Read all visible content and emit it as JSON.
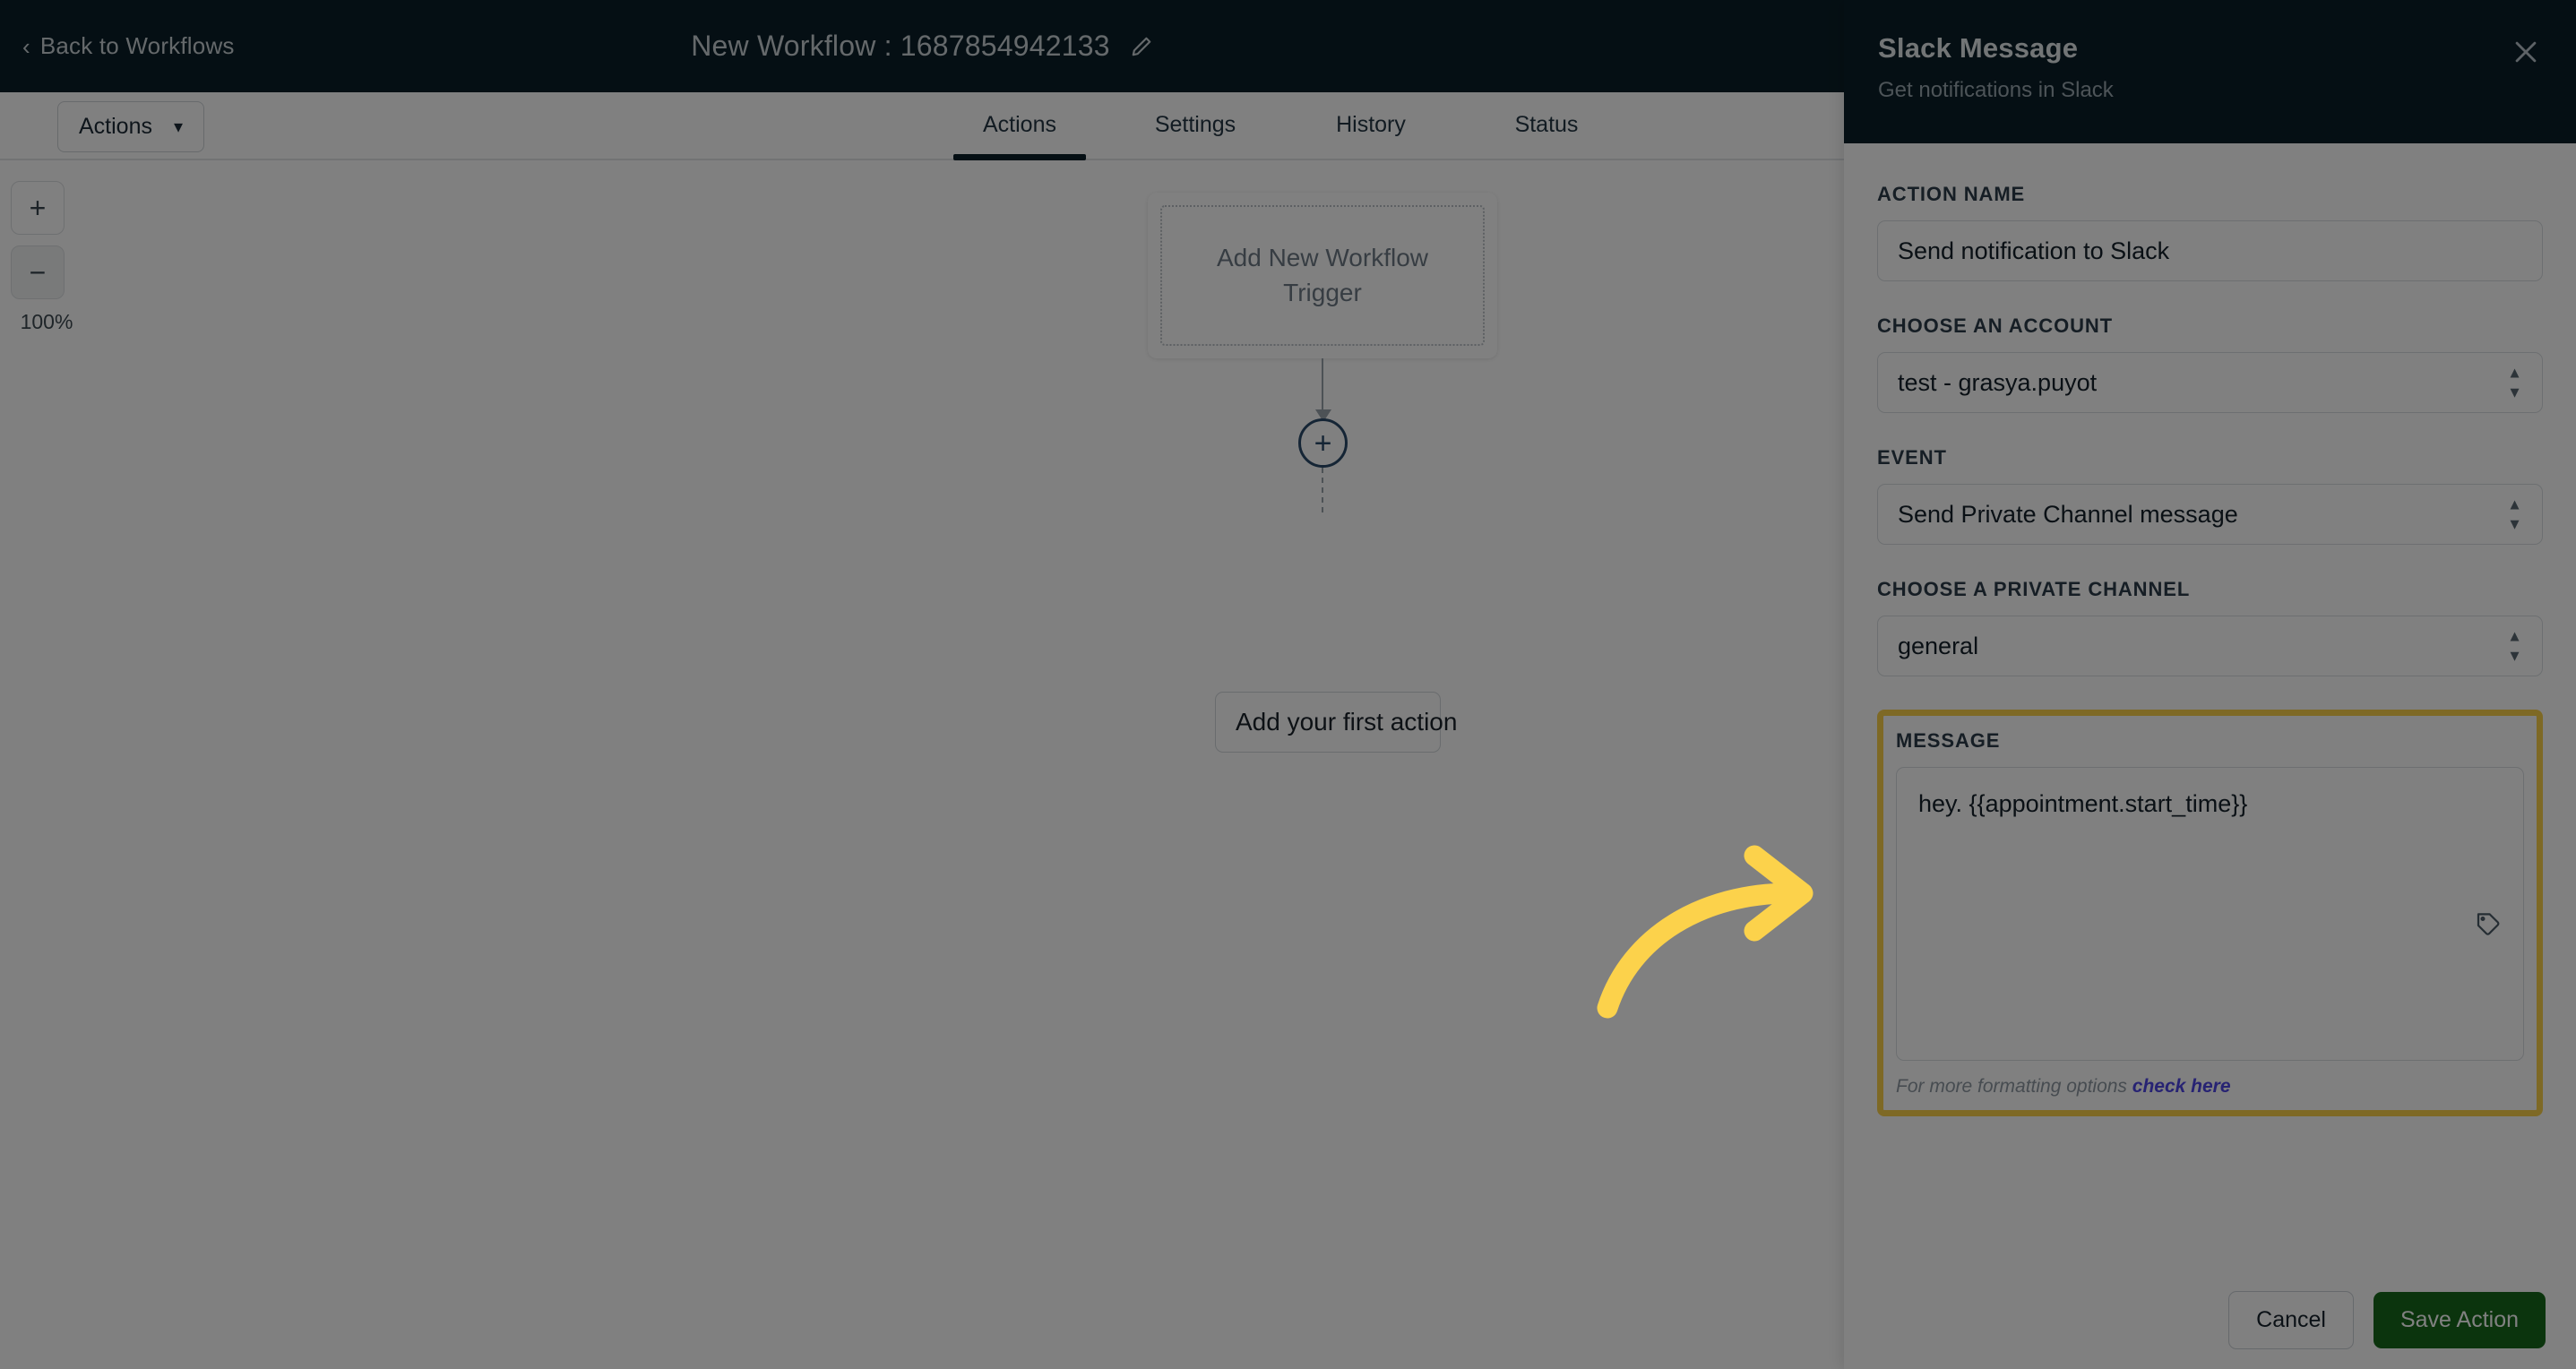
{
  "topbar": {
    "back_label": "Back to Workflows",
    "back_icon": "chevron-left-icon",
    "workflow_title": "New Workflow : 1687854942133",
    "edit_icon": "pencil-icon"
  },
  "toolbar": {
    "actions_dropdown_label": "Actions",
    "caret_icon": "chevron-down-icon"
  },
  "tabs": [
    {
      "label": "Actions",
      "active": true
    },
    {
      "label": "Settings",
      "active": false
    },
    {
      "label": "History",
      "active": false
    },
    {
      "label": "Status",
      "active": false
    }
  ],
  "canvas": {
    "zoom": {
      "in_label": "+",
      "out_label": "−",
      "level": "100%"
    },
    "trigger_card_label": "Add New Workflow Trigger",
    "add_node_label": "+",
    "first_action_label": "Add your first action"
  },
  "panel": {
    "title": "Slack Message",
    "subtitle": "Get notifications in Slack",
    "close_icon": "close-icon",
    "fields": {
      "action_name": {
        "label": "ACTION NAME",
        "value": "Send notification to Slack"
      },
      "account": {
        "label": "CHOOSE AN ACCOUNT",
        "value": "test - grasya.puyot"
      },
      "event": {
        "label": "EVENT",
        "value": "Send Private Channel message"
      },
      "channel": {
        "label": "CHOOSE A PRIVATE CHANNEL",
        "value": "general"
      },
      "message": {
        "label": "MESSAGE",
        "value": "hey. {{appointment.start_time}}",
        "tag_icon": "tag-icon",
        "help_text": "For more formatting options",
        "help_link": "check here"
      }
    },
    "footer": {
      "cancel_label": "Cancel",
      "save_label": "Save Action"
    }
  },
  "annotation": {
    "arrow_icon": "curved-arrow-right-icon",
    "arrow_color": "#fcd24b"
  },
  "colors": {
    "topbar_bg": "#0b1f28",
    "highlight": "#fcd24b",
    "save_green": "#16691a",
    "link_purple": "#4f46e5",
    "tab_active_underline": "#0b1f28"
  }
}
